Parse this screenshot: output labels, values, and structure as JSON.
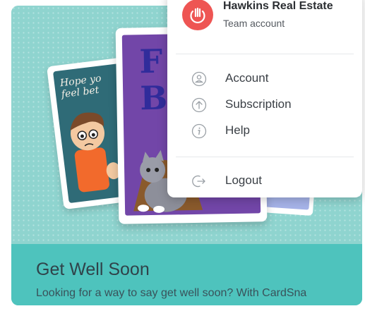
{
  "card": {
    "title": "Get Well Soon",
    "description": "Looking for a way to say get well soon? With CardSna",
    "left_card_text": "Hope yo\nfeel bet",
    "middle_card_text": "F\nBe"
  },
  "account_menu": {
    "team_name": "Hawkins Real Estate",
    "team_type": "Team account",
    "items": [
      {
        "label": "Account",
        "icon": "user-circle-icon"
      },
      {
        "label": "Subscription",
        "icon": "arrow-up-circle-icon"
      },
      {
        "label": "Help",
        "icon": "info-circle-icon"
      }
    ],
    "logout_label": "Logout",
    "logout_icon": "logout-arrow-icon"
  },
  "colors": {
    "avatar": "#ee5553",
    "tile_background": "#8fd4cf",
    "caption_band": "#4ec3bd",
    "menu_icon": "#9aa0a6"
  }
}
